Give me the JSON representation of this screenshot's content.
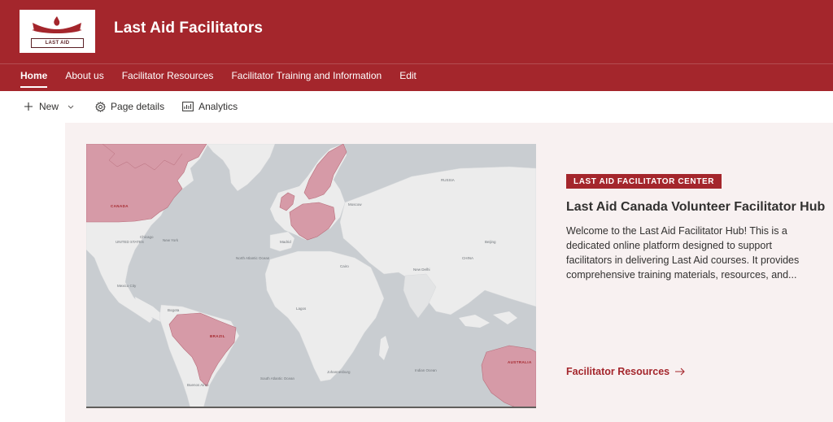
{
  "header": {
    "logo_text": "LAST AID",
    "site_title": "Last Aid Facilitators",
    "brand_color": "#a4262c"
  },
  "nav": {
    "items": [
      {
        "label": "Home",
        "active": true
      },
      {
        "label": "About us"
      },
      {
        "label": "Facilitator Resources"
      },
      {
        "label": "Facilitator Training and Information"
      },
      {
        "label": "Edit"
      }
    ]
  },
  "command_bar": {
    "new_label": "New",
    "page_details_label": "Page details",
    "analytics_label": "Analytics",
    "icons": [
      "plus-icon",
      "chevron-down-icon",
      "gear-icon",
      "analytics-icon"
    ]
  },
  "hero": {
    "tag": "LAST AID FACILITATOR CENTER",
    "title": "Last Aid Canada Volunteer Facilitator Hub",
    "description": "Welcome to the Last Aid Facilitator Hub! This is a dedicated online platform designed to support facilitators in delivering Last Aid courses. It provides comprehensive training materials, resources, and...",
    "link_label": "Facilitator Resources",
    "map": {
      "labels": {
        "russia": "RUSSIA",
        "united_states": "UNITED STATES",
        "canada": "CANADA",
        "china": "CHINA",
        "brazil": "BRAZIL",
        "australia": "AUSTRALIA",
        "north_atlantic": "North Atlantic Ocean",
        "south_atlantic": "South Atlantic Ocean",
        "indian_ocean": "Indian Ocean",
        "new_york": "New York",
        "chicago": "Chicago",
        "mexico_city": "Mexico City",
        "madrid": "Madrid",
        "moscow": "Moscow",
        "cairo": "Cairo",
        "new_delhi": "New Delhi",
        "beijing": "Beijing",
        "lagos": "Lagos",
        "johannesburg": "Johannesburg",
        "buenos_aires": "Buenos Aires",
        "bogota": "Bogota"
      }
    }
  }
}
